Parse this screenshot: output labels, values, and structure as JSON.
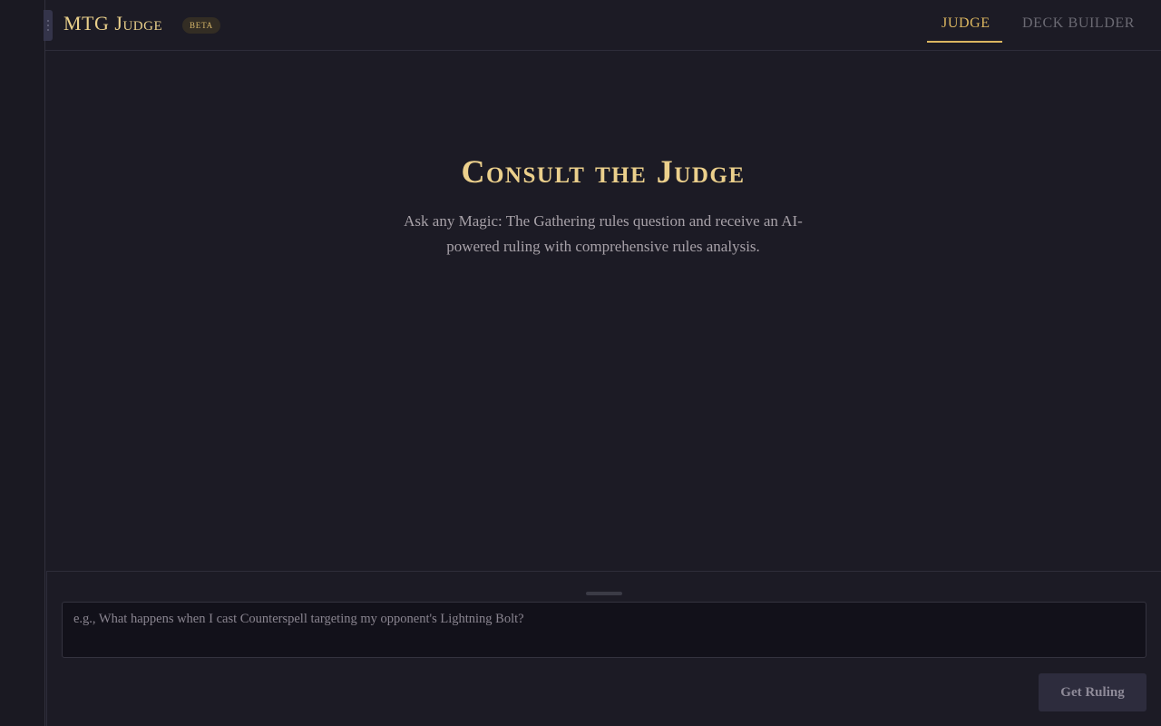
{
  "header": {
    "brand": "MTG Judge",
    "badge": "BETA",
    "tabs": [
      {
        "label": "JUDGE",
        "active": true
      },
      {
        "label": "DECK BUILDER",
        "active": false
      }
    ]
  },
  "hero": {
    "title": "Consult the Judge",
    "subtitle": "Ask any Magic: The Gathering rules question and receive an AI-powered ruling with comprehensive rules analysis."
  },
  "composer": {
    "placeholder": "e.g., What happens when I cast Counterspell targeting my opponent's Lightning Bolt?",
    "value": "",
    "submit_label": "Get Ruling"
  },
  "colors": {
    "background": "#1c1b25",
    "accent_gold": "#dbb660",
    "title_gold": "#ecd08c",
    "muted_text": "#a7a1a8"
  }
}
